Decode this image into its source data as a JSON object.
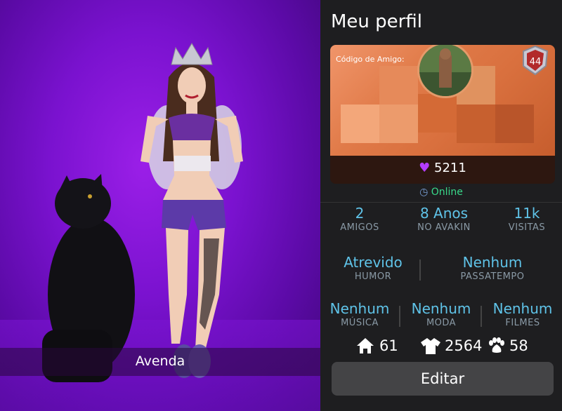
{
  "avatar": {
    "name": "Avenda"
  },
  "profile": {
    "title": "Meu perfil",
    "friend_code_label": "Código de Amigo:",
    "level": "44",
    "likes": "5211",
    "status": "Online"
  },
  "stats_row1": [
    {
      "value": "2",
      "label": "AMIGOS"
    },
    {
      "value": "8 Anos",
      "label": "NO AVAKIN"
    },
    {
      "value": "11k",
      "label": "VISITAS"
    }
  ],
  "stats_row2": [
    {
      "value": "Atrevido",
      "label": "HUMOR"
    },
    {
      "value": "Nenhum",
      "label": "PASSATEMPO"
    }
  ],
  "stats_row3": [
    {
      "value": "Nenhum",
      "label": "MÚSICA"
    },
    {
      "value": "Nenhum",
      "label": "MODA"
    },
    {
      "value": "Nenhum",
      "label": "FILMES"
    }
  ],
  "counts": {
    "homes": "61",
    "outfits": "2564",
    "pets": "58"
  },
  "edit_label": "Editar",
  "colors": {
    "accent": "#5fc3e8",
    "online": "#39d98a",
    "heart": "#b43cff"
  }
}
